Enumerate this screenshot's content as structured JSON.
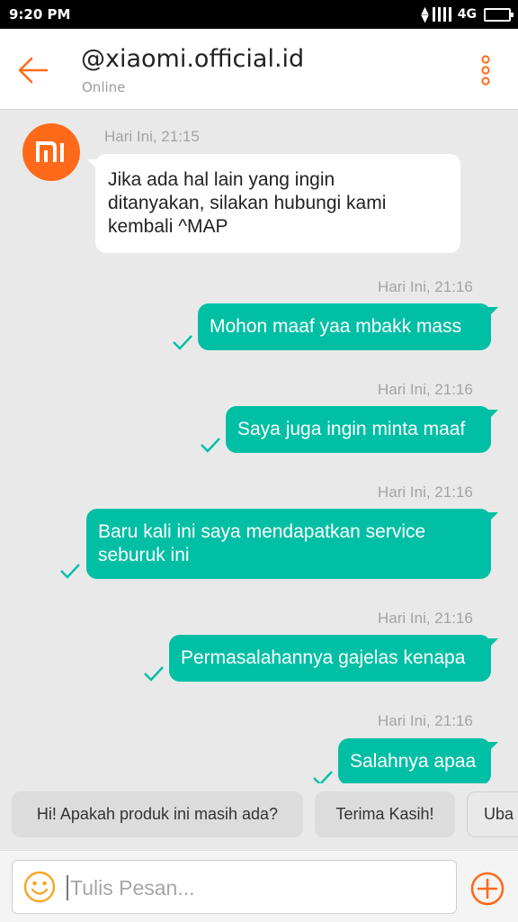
{
  "status_bar": {
    "time": "9:20 PM",
    "network": "4G"
  },
  "header": {
    "title": "@xiaomi.official.id",
    "status": "Online"
  },
  "messages": [
    {
      "direction": "in",
      "time": "Hari Ini, 21:15",
      "lines": [
        "Jika ada hal lain yang ingin",
        "ditanyakan, silakan hubungi kami",
        "kembali ^MAP"
      ]
    },
    {
      "direction": "out",
      "time": "Hari Ini, 21:16",
      "lines": [
        "Mohon maaf yaa mbakk mass"
      ]
    },
    {
      "direction": "out",
      "time": "Hari Ini, 21:16",
      "lines": [
        "Saya juga ingin minta maaf"
      ]
    },
    {
      "direction": "out",
      "time": "Hari Ini, 21:16",
      "lines": [
        "Baru kali ini saya mendapatkan service",
        "seburuk ini"
      ]
    },
    {
      "direction": "out",
      "time": "Hari Ini, 21:16",
      "lines": [
        "Permasalahannya gajelas kenapa"
      ]
    },
    {
      "direction": "out",
      "time": "Hari Ini, 21:16",
      "lines": [
        "Salahnya apaa"
      ]
    }
  ],
  "quick_replies": [
    "Hi! Apakah produk ini masih ada?",
    "Terima Kasih!",
    "Uba"
  ],
  "composer": {
    "placeholder": "Tulis Pesan..."
  },
  "colors": {
    "accent": "#ff6a1a",
    "bubble_out": "#00bfa5",
    "check": "#00bfa5"
  }
}
